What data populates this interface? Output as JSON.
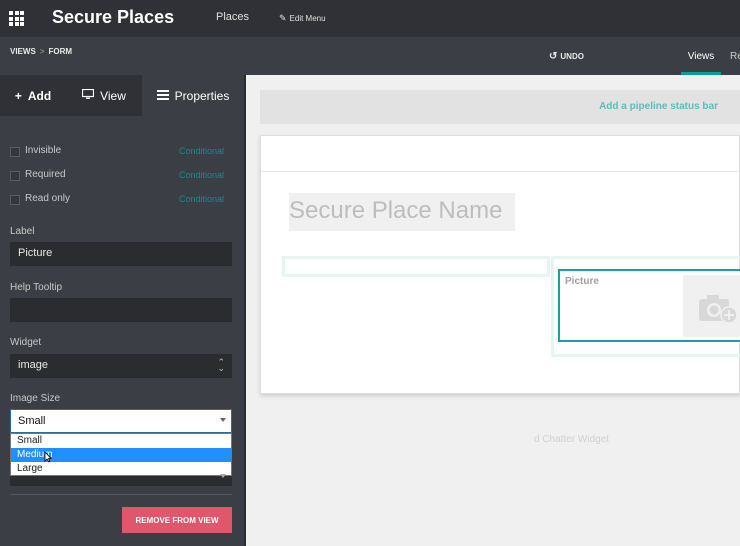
{
  "app": {
    "title": "Secure Places"
  },
  "topmenu": {
    "places": "Places",
    "edit_menu": "Edit Menu"
  },
  "breadcrumb": {
    "views": "VIEWS",
    "separator": ">",
    "form": "FORM"
  },
  "toolbar": {
    "undo": "UNDO",
    "tab_views": "Views",
    "tab_partial": "Re"
  },
  "sidebar": {
    "tabs": {
      "add": "Add",
      "view": "View",
      "properties": "Properties"
    },
    "flags": [
      {
        "label": "Invisible",
        "condition": "Conditional"
      },
      {
        "label": "Required",
        "condition": "Conditional"
      },
      {
        "label": "Read only",
        "condition": "Conditional"
      }
    ],
    "label_field": {
      "label": "Label",
      "value": "Picture"
    },
    "tooltip_field": {
      "label": "Help Tooltip",
      "value": ""
    },
    "widget_field": {
      "label": "Widget",
      "value": "image"
    },
    "image_size": {
      "label": "Image Size",
      "selected": "Small",
      "options": [
        "Small",
        "Medium",
        "Large"
      ],
      "highlighted": "Medium"
    },
    "remove_button": "REMOVE FROM VIEW"
  },
  "main": {
    "status_bar_link": "Add a pipeline status bar",
    "name_placeholder": "Secure Place Name",
    "picture_label": "Picture",
    "chatter_text": "d Chatter Widget"
  },
  "colors": {
    "accent": "#00a09d",
    "danger": "#e0566a",
    "dark": "#2f3136"
  }
}
